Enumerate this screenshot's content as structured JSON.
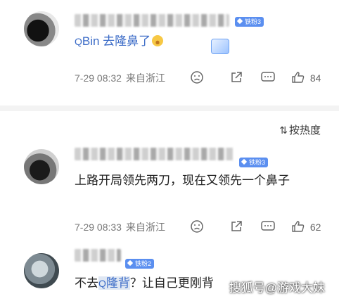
{
  "comments": [
    {
      "badge": "铁粉3",
      "text_prefix": "Bin 去隆鼻了",
      "time": "7-29 08:32",
      "location": "来自浙江",
      "likes": "84"
    },
    {
      "badge": "铁粉3",
      "text": "上路开局领先两刀，现在又领先一个鼻子",
      "time": "7-29 08:33",
      "location": "来自浙江",
      "likes": "62"
    },
    {
      "badge": "铁粉2",
      "text_before": "不去",
      "text_link": "隆背",
      "text_after": "？让自己更刚背"
    }
  ],
  "sort": {
    "label": "按热度"
  },
  "watermark": "搜狐号@游戏大妹",
  "icons": [
    "search-icon",
    "emoji-icon",
    "share-icon",
    "comment-icon",
    "like-icon",
    "sort-icon",
    "badge-diamond-icon"
  ]
}
